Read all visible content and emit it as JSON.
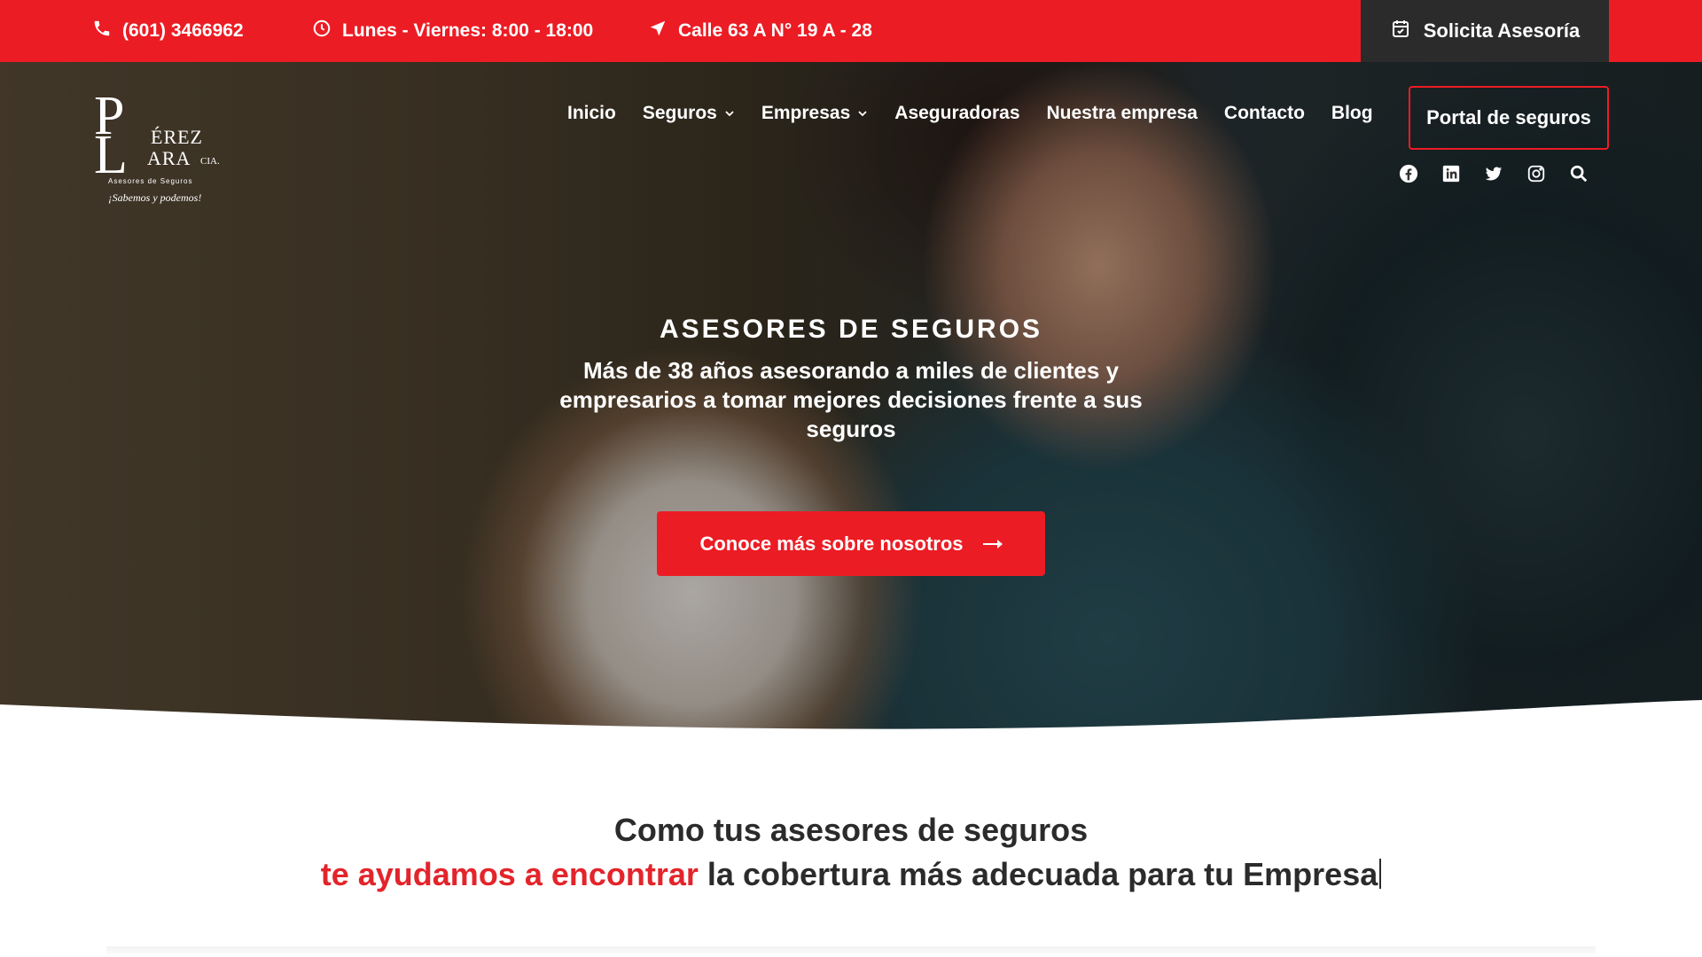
{
  "topbar": {
    "phone": "(601) 3466962",
    "hours": "Lunes - Viernes: 8:00 - 18:00",
    "address": "Calle 63 A N° 19 A - 28",
    "cta_label": "Solicita Asesoría",
    "icons": [
      "phone-icon",
      "clock-icon",
      "location-arrow-icon",
      "calendar-check-icon"
    ]
  },
  "logo": {
    "letter_p": "P",
    "letter_l": "L",
    "erez": "ÉREZ",
    "ara": "ARA",
    "cia": "CIA.",
    "subtitle": "Asesores de Seguros",
    "tagline": "¡Sabemos y podemos!"
  },
  "nav": {
    "items": [
      {
        "label": "Inicio",
        "has_dropdown": false
      },
      {
        "label": "Seguros",
        "has_dropdown": true
      },
      {
        "label": "Empresas",
        "has_dropdown": true
      },
      {
        "label": "Aseguradoras",
        "has_dropdown": false
      },
      {
        "label": "Nuestra empresa",
        "has_dropdown": false
      },
      {
        "label": "Contacto",
        "has_dropdown": false
      },
      {
        "label": "Blog",
        "has_dropdown": false
      }
    ],
    "portal_label": "Portal de seguros",
    "social_icons": [
      "facebook-icon",
      "linkedin-icon",
      "twitter-icon",
      "instagram-icon",
      "search-icon"
    ]
  },
  "hero": {
    "eyebrow": "ASESORES DE SEGUROS",
    "lead": "Más de 38 años asesorando a miles de clientes y empresarios a tomar mejores decisiones frente a sus seguros",
    "button_label": "Conoce más sobre nosotros"
  },
  "intro": {
    "line1": "Como tus asesores de seguros",
    "accent": "te ayudamos a encontrar",
    "rest": "la cobertura más adecuada para tu Empresa"
  },
  "colors": {
    "brand_red": "#ec1c24",
    "dark": "#2b2b2b",
    "white": "#ffffff"
  }
}
